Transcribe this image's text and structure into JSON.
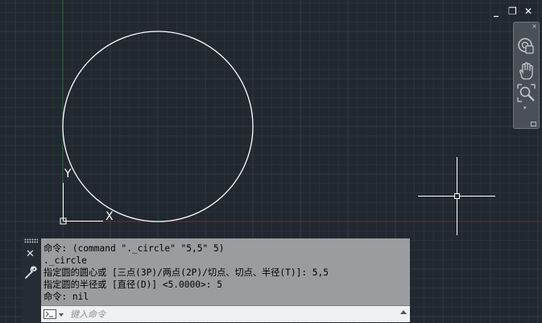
{
  "window_controls": {
    "minimize": "_",
    "restore": "❐",
    "close": "✕"
  },
  "ucs": {
    "y_label": "Y",
    "x_label": "X"
  },
  "navigation_bar": {
    "close_glyph": "×",
    "items": [
      "steering-wheel",
      "pan",
      "zoom-extents"
    ],
    "arrow_glyph": "▾"
  },
  "command_window": {
    "close_glyph": "✕",
    "history": [
      "命令: (command \"._circle\" \"5,5\" 5)",
      "._circle",
      "指定圆的圆心或 [三点(3P)/两点(2P)/切点、切点、半径(T)]: 5,5",
      "指定圆的半径或 [直径(D)] <5.0000>: 5",
      "命令: nil"
    ],
    "input_placeholder": "键入命令",
    "input_value": ""
  },
  "colors": {
    "background": "#212830",
    "grid_minor": "#2a313a",
    "grid_major": "#323a44",
    "x_axis": "#6b2a30",
    "y_axis": "#2d6a34",
    "circle": "#ffffff"
  }
}
